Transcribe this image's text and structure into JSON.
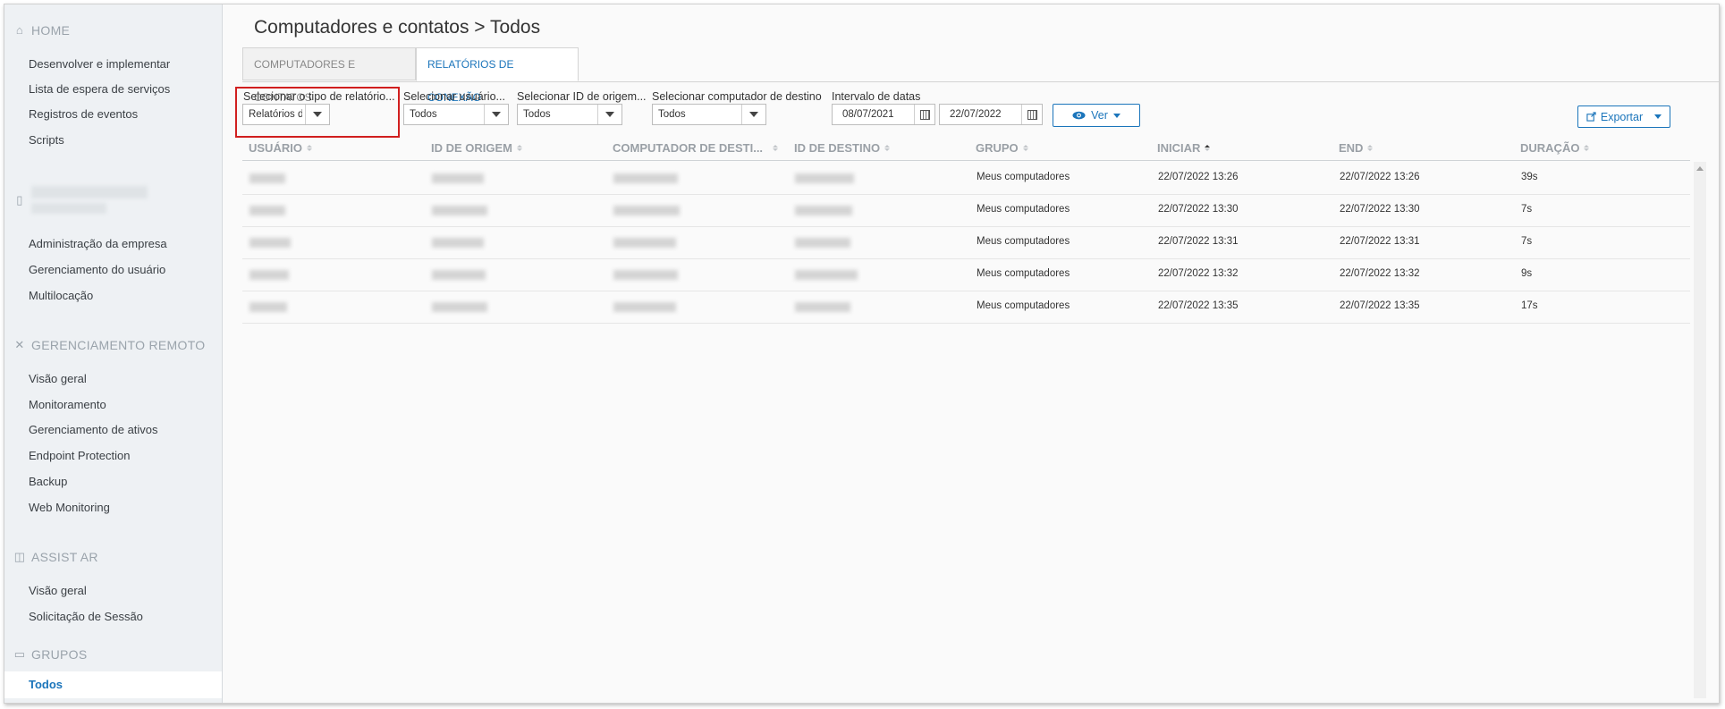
{
  "sidebar": {
    "home": {
      "header": "HOME",
      "items": [
        "Desenvolver e implementar",
        "Lista de espera de serviços",
        "Registros de eventos",
        "Scripts"
      ]
    },
    "company": {
      "items": [
        "Administração da empresa",
        "Gerenciamento do usuário",
        "Multilocação"
      ]
    },
    "remote": {
      "header": "GERENCIAMENTO REMOTO",
      "items": [
        "Visão geral",
        "Monitoramento",
        "Gerenciamento de ativos",
        "Endpoint Protection",
        "Backup",
        "Web Monitoring"
      ]
    },
    "assist": {
      "header": "ASSIST AR",
      "items": [
        "Visão geral",
        "Solicitação de Sessão"
      ]
    },
    "groups": {
      "header": "GRUPOS",
      "active_item": "Todos"
    }
  },
  "main": {
    "title": "Computadores e contatos > Todos",
    "tabs": [
      "COMPUTADORES E CONTATOS",
      "RELATÓRIOS DE CONEXÃO"
    ],
    "filters": {
      "report_type": {
        "label": "Selecionar o tipo de relatório...",
        "value": "Relatórios de dis"
      },
      "user": {
        "label": "Selecionar usuário...",
        "value": "Todos"
      },
      "origin": {
        "label": "Selecionar ID de origem...",
        "value": "Todos"
      },
      "dest_computer": {
        "label": "Selecionar computador de destino",
        "value": "Todos"
      },
      "dates": {
        "label": "Intervalo de datas",
        "from": "08/07/2021",
        "to": "22/07/2022"
      }
    },
    "view_button": "Ver",
    "export_button": "Exportar"
  },
  "table": {
    "columns": [
      "USUÁRIO",
      "ID DE ORIGEM",
      "COMPUTADOR DE DESTI...",
      "ID DE DESTINO",
      "GRUPO",
      "INICIAR",
      "END",
      "DURAÇÃO"
    ],
    "rows": [
      {
        "group": "Meus computadores",
        "start": "22/07/2022 13:26",
        "end": "22/07/2022 13:26",
        "duration": "39s"
      },
      {
        "group": "Meus computadores",
        "start": "22/07/2022 13:30",
        "end": "22/07/2022 13:30",
        "duration": "7s"
      },
      {
        "group": "Meus computadores",
        "start": "22/07/2022 13:31",
        "end": "22/07/2022 13:31",
        "duration": "7s"
      },
      {
        "group": "Meus computadores",
        "start": "22/07/2022 13:32",
        "end": "22/07/2022 13:32",
        "duration": "9s"
      },
      {
        "group": "Meus computadores",
        "start": "22/07/2022 13:35",
        "end": "22/07/2022 13:35",
        "duration": "17s"
      }
    ]
  },
  "colors": {
    "accent": "#1b75bb",
    "highlight": "#d11f1f"
  }
}
